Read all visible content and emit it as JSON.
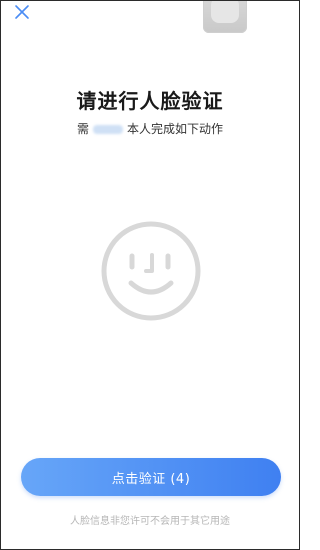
{
  "header": {
    "close_icon": "close-icon",
    "camera_preview": "camera-preview-thumbnail"
  },
  "main": {
    "title": "请进行人脸验证",
    "subtitle_prefix": "需",
    "subtitle_suffix": "本人完成如下动作",
    "face_icon": "face-outline-icon"
  },
  "action": {
    "button_label": "点击验证 (4)"
  },
  "footer": {
    "note": "人脸信息非您许可不会用于其它用途"
  },
  "colors": {
    "accent": "#4a8cf4",
    "close_icon": "#4a8cf4",
    "face_icon": "#d8d8d8"
  }
}
